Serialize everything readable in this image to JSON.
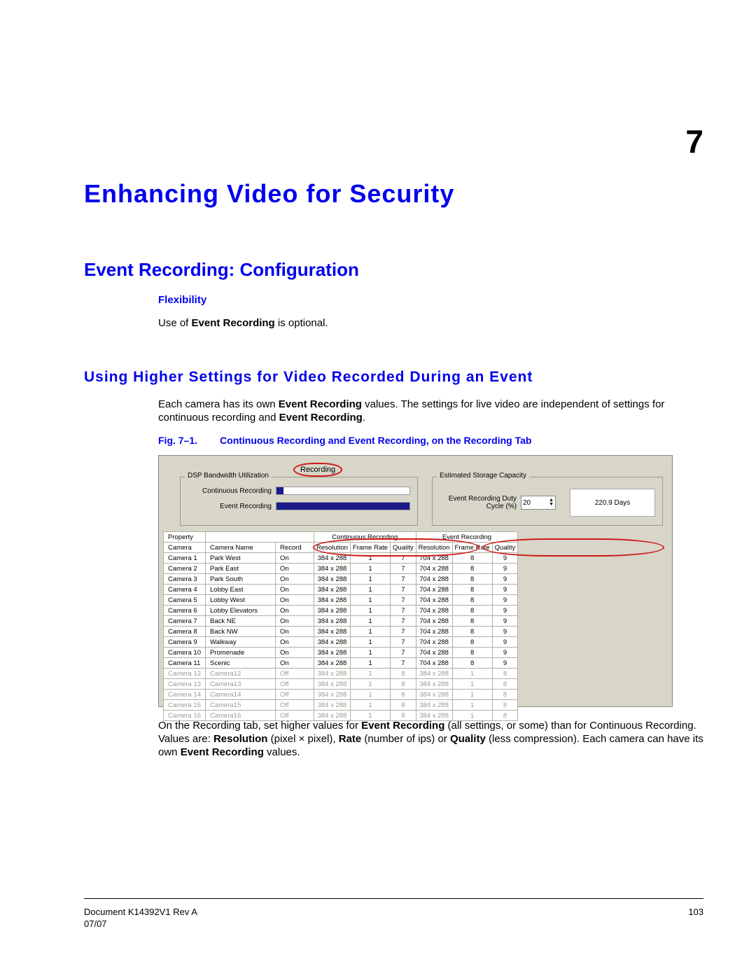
{
  "chapter_number": "7",
  "title": "Enhancing Video for Security",
  "h2": "Event Recording: Configuration",
  "h4": "Flexibility",
  "para1_a": "Use of ",
  "para1_b": "Event Recording",
  "para1_c": " is optional.",
  "h3": "Using Higher Settings for Video Recorded During an Event",
  "para2_a": "Each camera has its own ",
  "para2_b": "Event Recording",
  "para2_c": " values. The settings for live video are independent of settings for continuous recording and ",
  "para2_d": "Event Recording",
  "para2_e": ".",
  "fig_label": "Fig. 7–1.",
  "fig_caption": "Continuous Recording and Event Recording, on the Recording Tab",
  "tab_label": "Recording",
  "dsp_legend": "DSP Bandwidth Utilization",
  "dsp_row1": "Continuous Recording",
  "dsp_row2": "Event Recording",
  "est_legend": "Estimated Storage Capacity",
  "est_label": "Event Recording Duty Cycle (%)",
  "est_value": "20",
  "est_days": "220.9 Days",
  "headers": {
    "property": "Property",
    "camera": "Camera",
    "camera_name": "Camera Name",
    "record": "Record",
    "cont": "Continuous Recording",
    "evt": "Event Recording",
    "resolution": "Resolution",
    "frame_rate": "Frame Rate",
    "quality": "Quality"
  },
  "rows": [
    {
      "cam": "Camera 1",
      "name": "Park West",
      "rec": "On",
      "cr": "384 x 288",
      "cf": "1",
      "cq": "7",
      "er": "704 x 288",
      "ef": "8",
      "eq": "9",
      "off": false
    },
    {
      "cam": "Camera 2",
      "name": "Park East",
      "rec": "On",
      "cr": "384 x 288",
      "cf": "1",
      "cq": "7",
      "er": "704 x 288",
      "ef": "8",
      "eq": "9",
      "off": false
    },
    {
      "cam": "Camera 3",
      "name": "Park South",
      "rec": "On",
      "cr": "384 x 288",
      "cf": "1",
      "cq": "7",
      "er": "704 x 288",
      "ef": "8",
      "eq": "9",
      "off": false
    },
    {
      "cam": "Camera 4",
      "name": "Lobby East",
      "rec": "On",
      "cr": "384 x 288",
      "cf": "1",
      "cq": "7",
      "er": "704 x 288",
      "ef": "8",
      "eq": "9",
      "off": false
    },
    {
      "cam": "Camera 5",
      "name": "Lobby West",
      "rec": "On",
      "cr": "384 x 288",
      "cf": "1",
      "cq": "7",
      "er": "704 x 288",
      "ef": "8",
      "eq": "9",
      "off": false
    },
    {
      "cam": "Camera 6",
      "name": "Lobby Elevators",
      "rec": "On",
      "cr": "384 x 288",
      "cf": "1",
      "cq": "7",
      "er": "704 x 288",
      "ef": "8",
      "eq": "9",
      "off": false
    },
    {
      "cam": "Camera 7",
      "name": "Back NE",
      "rec": "On",
      "cr": "384 x 288",
      "cf": "1",
      "cq": "7",
      "er": "704 x 288",
      "ef": "8",
      "eq": "9",
      "off": false
    },
    {
      "cam": "Camera 8",
      "name": "Back NW",
      "rec": "On",
      "cr": "384 x 288",
      "cf": "1",
      "cq": "7",
      "er": "704 x 288",
      "ef": "8",
      "eq": "9",
      "off": false
    },
    {
      "cam": "Camera 9",
      "name": "Walkway",
      "rec": "On",
      "cr": "384 x 288",
      "cf": "1",
      "cq": "7",
      "er": "704 x 288",
      "ef": "8",
      "eq": "9",
      "off": false
    },
    {
      "cam": "Camera 10",
      "name": "Promenade",
      "rec": "On",
      "cr": "384 x 288",
      "cf": "1",
      "cq": "7",
      "er": "704 x 288",
      "ef": "8",
      "eq": "9",
      "off": false
    },
    {
      "cam": "Camera 11",
      "name": "Scenic",
      "rec": "On",
      "cr": "384 x 288",
      "cf": "1",
      "cq": "7",
      "er": "704 x 288",
      "ef": "8",
      "eq": "9",
      "off": false
    },
    {
      "cam": "Camera 12",
      "name": "Camera12",
      "rec": "Off",
      "cr": "384 x 288",
      "cf": "1",
      "cq": "8",
      "er": "384 x 288",
      "ef": "1",
      "eq": "8",
      "off": true
    },
    {
      "cam": "Camera 13",
      "name": "Camera13",
      "rec": "Off",
      "cr": "384 x 288",
      "cf": "1",
      "cq": "8",
      "er": "384 x 288",
      "ef": "1",
      "eq": "8",
      "off": true
    },
    {
      "cam": "Camera 14",
      "name": "Camera14",
      "rec": "Off",
      "cr": "384 x 288",
      "cf": "1",
      "cq": "8",
      "er": "384 x 288",
      "ef": "1",
      "eq": "8",
      "off": true
    },
    {
      "cam": "Camera 15",
      "name": "Camera15",
      "rec": "Off",
      "cr": "384 x 288",
      "cf": "1",
      "cq": "8",
      "er": "384 x 288",
      "ef": "1",
      "eq": "8",
      "off": true
    },
    {
      "cam": "Camera 16",
      "name": "Camera16",
      "rec": "Off",
      "cr": "384 x 288",
      "cf": "1",
      "cq": "8",
      "er": "384 x 288",
      "ef": "1",
      "eq": "8",
      "off": true
    }
  ],
  "para3_a": "On the Recording tab, set higher values for ",
  "para3_b": "Event Recording",
  "para3_c": " (all settings, or some) than for Continuous Recording. Values are: ",
  "para3_d": "Resolution",
  "para3_e": " (pixel × pixel), ",
  "para3_f": "Rate",
  "para3_g": " (number of ips) or ",
  "para3_h": "Quality",
  "para3_i": " (less compression). Each camera can have its own ",
  "para3_j": "Event Recording",
  "para3_k": " values.",
  "footer_doc": "Document K14392V1 Rev A",
  "footer_date": "07/07",
  "footer_page": "103"
}
